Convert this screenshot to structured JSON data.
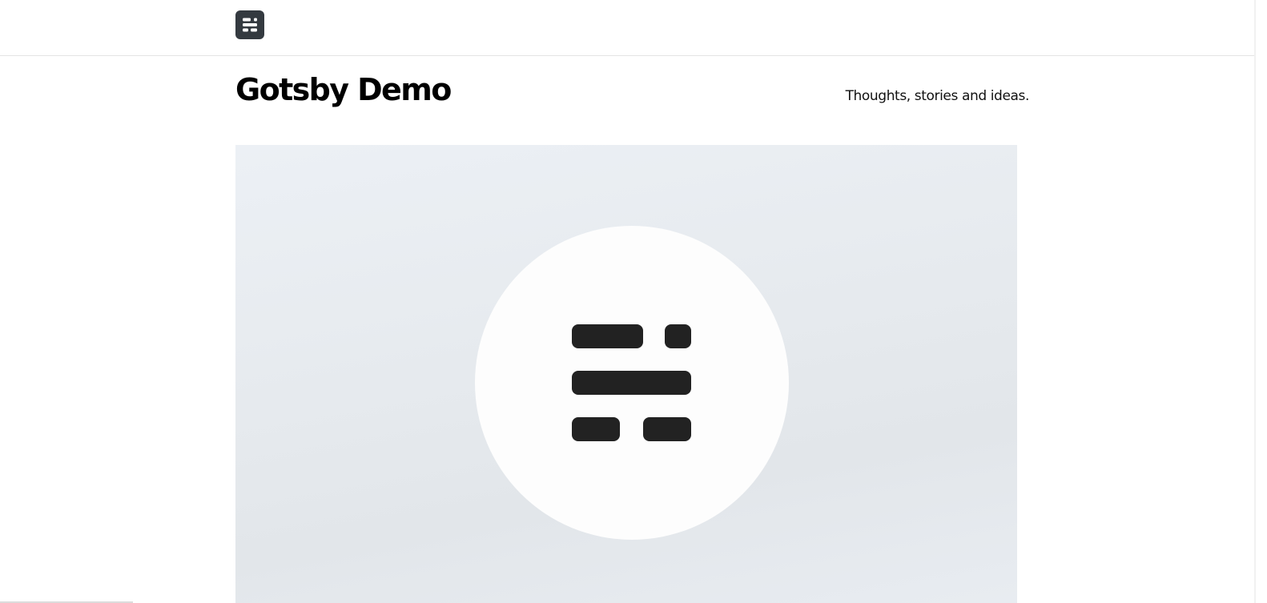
{
  "header": {
    "logo_icon": "ghost-logo-icon",
    "logo_color": "#343a40"
  },
  "site": {
    "title": "Gotsby Demo",
    "tagline": "Thoughts, stories and ideas."
  },
  "hero": {
    "image_icon": "ghost-logo-icon",
    "background": "#e6eaee",
    "circle_color": "#fdfdfd",
    "glyph_color": "#222222"
  }
}
